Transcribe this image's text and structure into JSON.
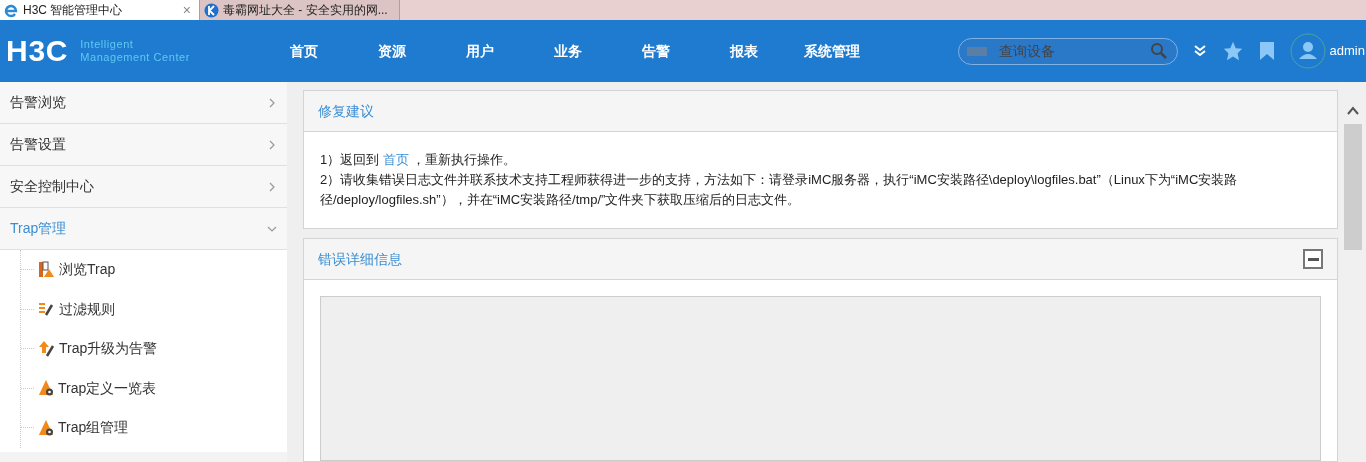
{
  "browser_tabs": [
    {
      "title": "H3C 智能管理中心",
      "selected": true,
      "close": "×"
    },
    {
      "title": "毒霸网址大全 - 安全实用的网...",
      "selected": false
    }
  ],
  "header": {
    "logo": "H3C",
    "logo_line1": "Intelligent",
    "logo_line2": "Management Center",
    "nav": [
      "首页",
      "资源",
      "用户",
      "业务",
      "告警",
      "报表",
      "系统管理"
    ],
    "search": {
      "placeholder": "查询设备"
    },
    "user": "admin"
  },
  "sidebar": [
    {
      "label": "告警浏览",
      "expanded": false
    },
    {
      "label": "告警设置",
      "expanded": false
    },
    {
      "label": "安全控制中心",
      "expanded": false
    },
    {
      "label": "Trap管理",
      "expanded": true,
      "children": [
        {
          "label": "浏览Trap",
          "kind": "browse"
        },
        {
          "label": "过滤规则",
          "kind": "filter"
        },
        {
          "label": "Trap升级为告警",
          "kind": "upgrade"
        },
        {
          "label": "Trap定义一览表",
          "kind": "define"
        },
        {
          "label": "Trap组管理",
          "kind": "group"
        }
      ]
    }
  ],
  "repair_panel": {
    "title": "修复建议",
    "line1": {
      "before": "1）返回到 ",
      "link": "首页",
      "after": " ，重新执行操作。"
    },
    "line2": "2）请收集错误日志文件并联系技术支持工程师获得进一步的支持，方法如下：请登录iMC服务器，执行“iMC安装路径\\deploy\\logfiles.bat”（Linux下为“iMC安装路径/deploy/logfiles.sh”），并在“iMC安装路径/tmp/”文件夹下获取压缩后的日志文件。"
  },
  "error_panel": {
    "title": "错误详细信息",
    "collapsed": false
  }
}
